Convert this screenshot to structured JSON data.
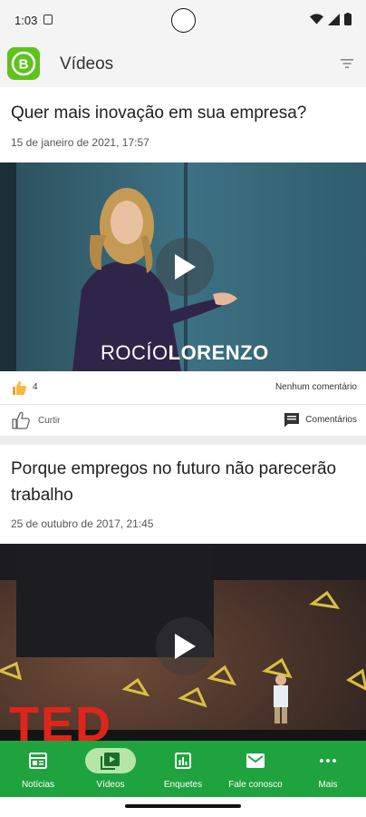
{
  "status_bar": {
    "time": "1:03"
  },
  "app_bar": {
    "title": "Vídeos",
    "logo_letter": "B"
  },
  "posts": [
    {
      "title": "Quer mais inovação em sua empresa?",
      "date": "15 de janeiro de 2021, 17:57",
      "video_caption_first": "ROCÍO",
      "video_caption_last": "LORENZO",
      "likes": "4",
      "comments": "Nenhum comentário",
      "like_label": "Curtir",
      "comments_label": "Comentários"
    },
    {
      "title": "Porque empregos no futuro não parecerão trabalho",
      "date": "25 de outubro de 2017, 21:45",
      "video_logo_text": "TED"
    }
  ],
  "nav": [
    {
      "label": "Notícias",
      "icon": "news-icon",
      "active": false
    },
    {
      "label": "Vídeos",
      "icon": "video-icon",
      "active": true
    },
    {
      "label": "Enquetes",
      "icon": "poll-icon",
      "active": false
    },
    {
      "label": "Fale conosco",
      "icon": "mail-icon",
      "active": false
    },
    {
      "label": "Mais",
      "icon": "more-icon",
      "active": false
    }
  ],
  "colors": {
    "brand_green": "#1fa33f",
    "active_pill": "#b5e6a8",
    "logo_green": "#5fc21d"
  }
}
